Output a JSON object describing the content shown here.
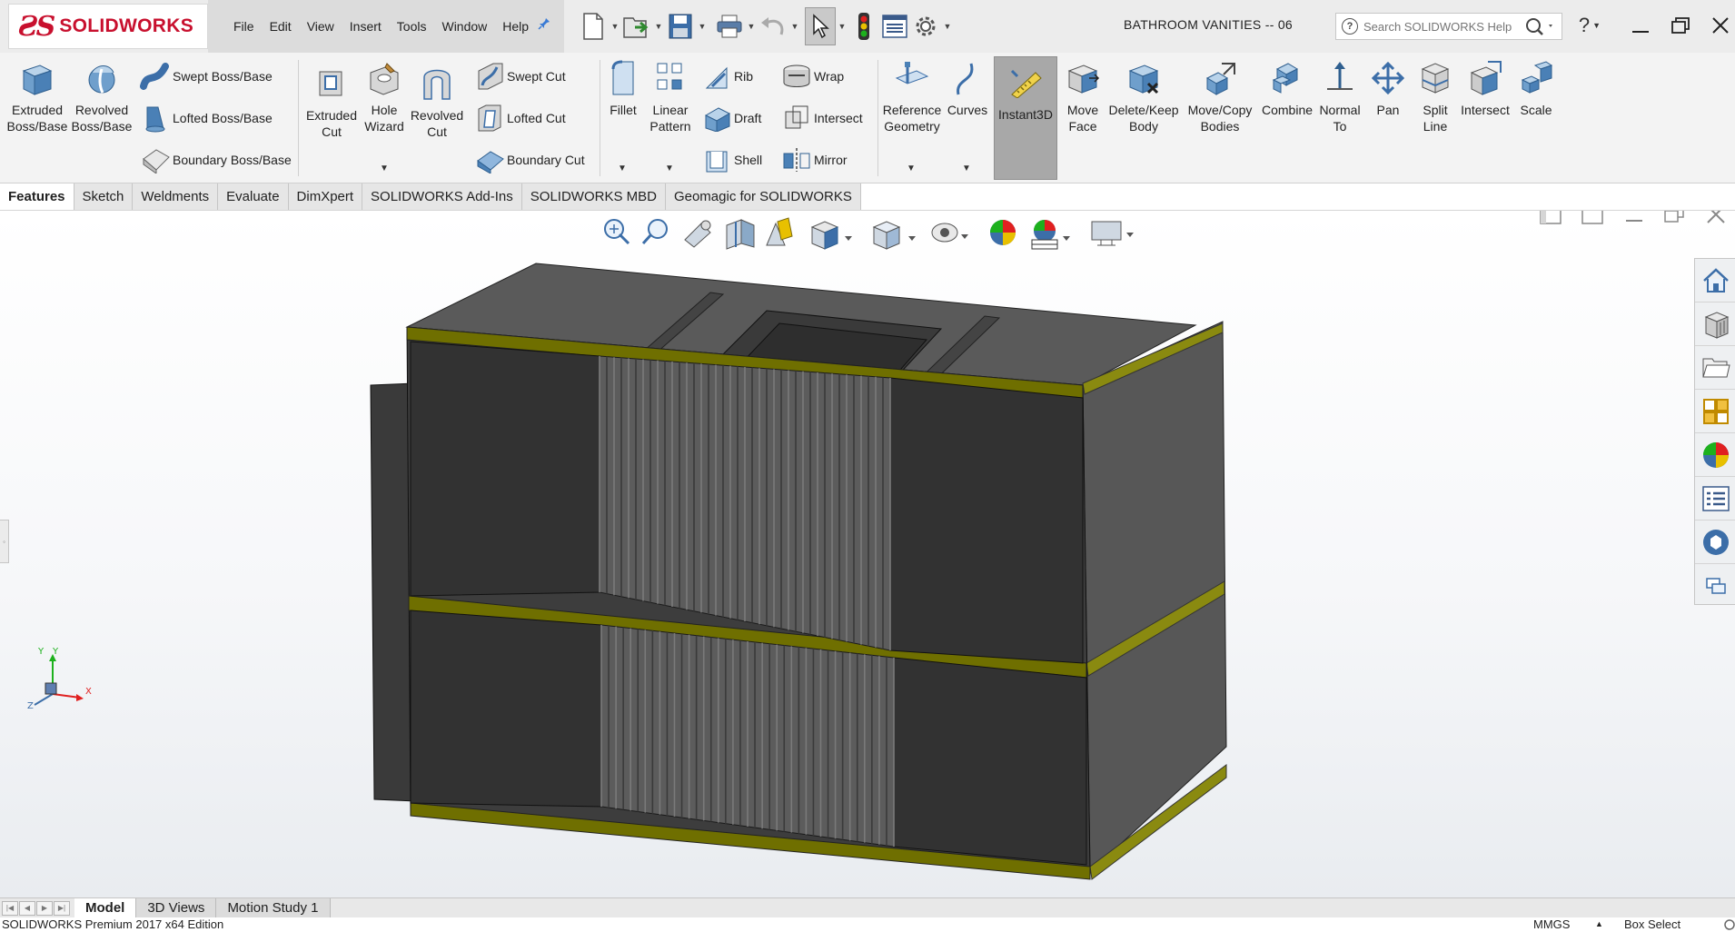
{
  "app": {
    "logo_text": "SOLIDWORKS",
    "document_title": "BATHROOM VANITIES -- 06"
  },
  "menu": [
    "File",
    "Edit",
    "View",
    "Insert",
    "Tools",
    "Window",
    "Help"
  ],
  "search": {
    "placeholder": "Search SOLIDWORKS Help"
  },
  "ribbon": {
    "extruded_boss": "Extruded Boss/Base",
    "revolved_boss": "Revolved Boss/Base",
    "swept_boss": "Swept Boss/Base",
    "lofted_boss": "Lofted Boss/Base",
    "boundary_boss": "Boundary Boss/Base",
    "extruded_cut": "Extruded Cut",
    "hole_wizard": "Hole Wizard",
    "revolved_cut": "Revolved Cut",
    "swept_cut": "Swept Cut",
    "lofted_cut": "Lofted Cut",
    "boundary_cut": "Boundary Cut",
    "fillet": "Fillet",
    "linear_pattern": "Linear Pattern",
    "rib": "Rib",
    "draft": "Draft",
    "shell": "Shell",
    "wrap": "Wrap",
    "intersect_small": "Intersect",
    "mirror": "Mirror",
    "reference_geometry": "Reference Geometry",
    "curves": "Curves",
    "instant3d": "Instant3D",
    "move_face": "Move Face",
    "delete_keep_body": "Delete/Keep Body",
    "move_copy_bodies": "Move/Copy Bodies",
    "combine": "Combine",
    "normal_to": "Normal To",
    "pan": "Pan",
    "split_line": "Split Line",
    "intersect": "Intersect",
    "scale": "Scale"
  },
  "tabs": [
    "Features",
    "Sketch",
    "Weldments",
    "Evaluate",
    "DimXpert",
    "SOLIDWORKS Add-Ins",
    "SOLIDWORKS MBD",
    "Geomagic for SOLIDWORKS"
  ],
  "bottom_tabs": [
    "Model",
    "3D Views",
    "Motion Study 1"
  ],
  "status": {
    "edition": "SOLIDWORKS Premium 2017 x64 Edition",
    "units": "MMGS",
    "units_arrow": "▲",
    "mode": "Box Select"
  },
  "triad": {
    "x": "X",
    "y": "Y",
    "z": "Z"
  },
  "colors": {
    "model_body": "#3d3d3d",
    "model_edge_band": "#6f6f00",
    "brand_red": "#c8102e"
  }
}
